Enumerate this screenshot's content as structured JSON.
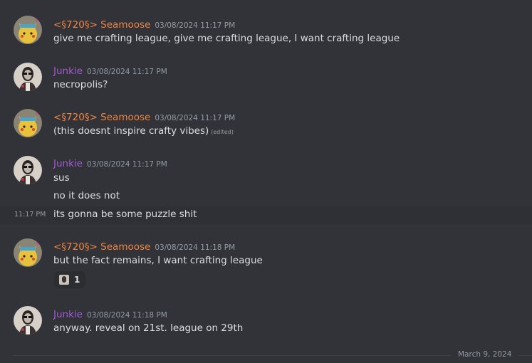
{
  "messages": [
    {
      "user": "<§720§> Seamoose",
      "timestamp": "03/08/2024 11:17 PM",
      "lines": [
        "give me crafting league, give me crafting league, I want crafting league"
      ]
    },
    {
      "user": "Junkie",
      "timestamp": "03/08/2024 11:17 PM",
      "lines": [
        "necropolis?"
      ]
    },
    {
      "user": "<§720§> Seamoose",
      "timestamp": "03/08/2024 11:17 PM",
      "lines": [
        "(this doesnt inspire crafty vibes)"
      ],
      "edited_label": "(edited)"
    },
    {
      "user": "Junkie",
      "timestamp": "03/08/2024 11:17 PM",
      "lines": [
        "sus",
        "no it does not",
        "its gonna be some puzzle shit"
      ],
      "hover_timestamp": "11:17 PM"
    },
    {
      "user": "<§720§> Seamoose",
      "timestamp": "03/08/2024 11:18 PM",
      "lines": [
        "but the fact remains, I want crafting league"
      ],
      "reaction": {
        "emoji": "junkie-avatar-emoji",
        "count": "1"
      }
    },
    {
      "user": "Junkie",
      "timestamp": "03/08/2024 11:18 PM",
      "lines": [
        "anyway. reveal on 21st. league on 29th"
      ]
    }
  ],
  "date_divider": "March 9, 2024",
  "colors": {
    "background": "#313338",
    "seamoose_name": "#f0853f",
    "junkie_name": "#a35ad1",
    "text": "#dbdee1",
    "muted": "#949ba4"
  }
}
